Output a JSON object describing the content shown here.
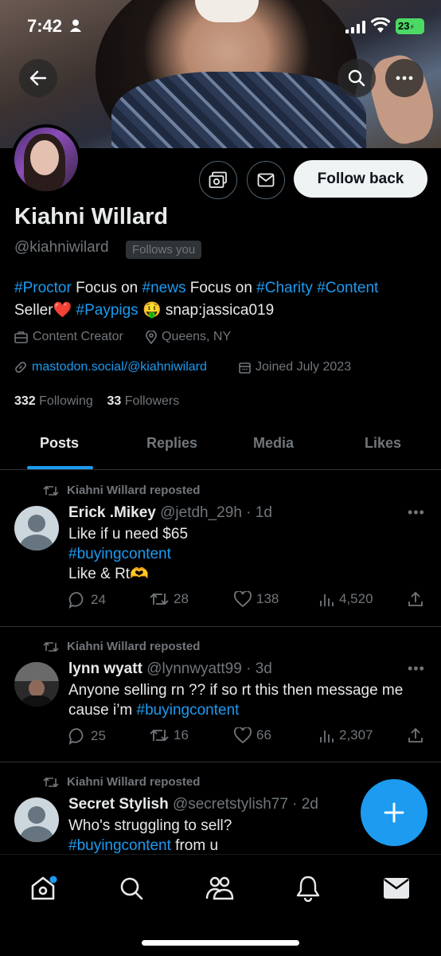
{
  "status_bar": {
    "time": "7:42",
    "battery": "23"
  },
  "profile": {
    "name": "Kiahni Willard",
    "handle": "@kiahniwilard",
    "follows_you": "Follows you",
    "follow_button": "Follow back",
    "bio": {
      "tag1": "#Proctor",
      "t1": " Focus on ",
      "tag2": "#news",
      "t2": " Focus on ",
      "tag3": "#Charity",
      "t3": " ",
      "tag4": "#Content",
      "t4": "Seller❤️ ",
      "tag5": "#Paypigs",
      "t5": " 🤑 snap:jassica019"
    },
    "category": "Content Creator",
    "location": "Queens, NY",
    "website": "mastodon.social/@kiahniwilard",
    "joined": "Joined July 2023",
    "following_count": "332",
    "following_label": "Following",
    "followers_count": "33",
    "followers_label": "Followers"
  },
  "tabs": [
    "Posts",
    "Replies",
    "Media",
    "Likes"
  ],
  "posts": [
    {
      "repost_label": "Kiahni Willard reposted",
      "author": "Erick .Mikey",
      "handle_time": "@jetdh_29h · 1d",
      "line1": "Like if u need $65",
      "hashtag": "#buyingcontent",
      "line3": "Like & Rt🫶",
      "replies": "24",
      "reposts": "28",
      "likes": "138",
      "views": "4,520"
    },
    {
      "repost_label": "Kiahni Willard reposted",
      "author": "lynn wyatt",
      "handle_time": "@lynnwyatt99 · 3d",
      "line1": "Anyone selling rn ?? if so rt this then message me",
      "line2a": "cause i’m ",
      "hashtag": "#buyingcontent",
      "replies": "25",
      "reposts": "16",
      "likes": "66",
      "views": "2,307"
    },
    {
      "repost_label": "Kiahni Willard reposted",
      "author": "Secret Stylish",
      "handle_time": "@secretstylish77 · 2d",
      "line1": "Who's struggling to sell?",
      "hashtag": "#buyingcontent",
      "line2b": " from u"
    }
  ],
  "colors": {
    "accent": "#1d9bf0",
    "muted": "#71767b",
    "background": "#000000"
  },
  "icons": [
    "back-arrow-icon",
    "search-icon",
    "more-icon",
    "subscribe-icon",
    "message-icon",
    "briefcase-icon",
    "location-icon",
    "link-icon",
    "calendar-icon",
    "repost-icon",
    "reply-icon",
    "like-icon",
    "views-icon",
    "share-icon",
    "compose-plus-icon",
    "home-icon",
    "explore-icon",
    "communities-icon",
    "notifications-icon",
    "messages-icon"
  ]
}
